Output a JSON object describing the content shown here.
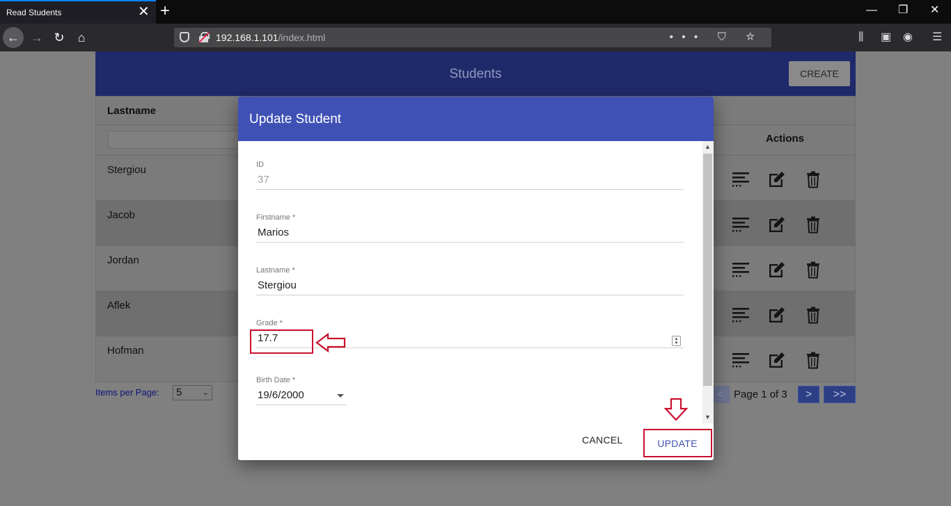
{
  "browser": {
    "tab_title": "Read Students",
    "tab_close": "✕",
    "new_tab": "+",
    "url_host": "192.168.1.101",
    "url_path": "/index.html",
    "url_actions": "••• ⛉ ☆",
    "window_controls": {
      "minimize": "—",
      "restore": "❐",
      "close": "✕"
    },
    "nav": {
      "back": "←",
      "forward": "→",
      "reload": "↻",
      "home": "⌂"
    },
    "toolbar": {
      "library": "⫼",
      "sidebar": "▣",
      "account": "◉",
      "menu": "☰"
    }
  },
  "app": {
    "title": "Students",
    "create_label": "CREATE",
    "columns": {
      "lastname": "Lastname",
      "actions": "Actions"
    },
    "rows": [
      {
        "lastname": "Stergiou"
      },
      {
        "lastname": "Jacob"
      },
      {
        "lastname": "Jordan"
      },
      {
        "lastname": "Aflek"
      },
      {
        "lastname": "Hofman"
      }
    ],
    "pagination": {
      "items_per_page_label": "Items per Page:",
      "items_per_page_value": "5",
      "prev": "<",
      "page_text": "Page 1 of 3",
      "next": ">",
      "last": ">>"
    }
  },
  "dialog": {
    "title": "Update Student",
    "fields": {
      "id": {
        "label": "ID",
        "value": "37"
      },
      "firstname": {
        "label": "Firstname *",
        "value": "Marios"
      },
      "lastname": {
        "label": "Lastname *",
        "value": "Stergiou"
      },
      "grade": {
        "label": "Grade *",
        "value": "17.7"
      },
      "birth_date": {
        "label": "Birth Date *",
        "value": "19/6/2000"
      }
    },
    "cancel_label": "CANCEL",
    "update_label": "UPDATE"
  },
  "colors": {
    "dialog_header": "#3f51b5",
    "annotation": "#c8102e",
    "app_header_dimmed": "#1f2a6b"
  }
}
